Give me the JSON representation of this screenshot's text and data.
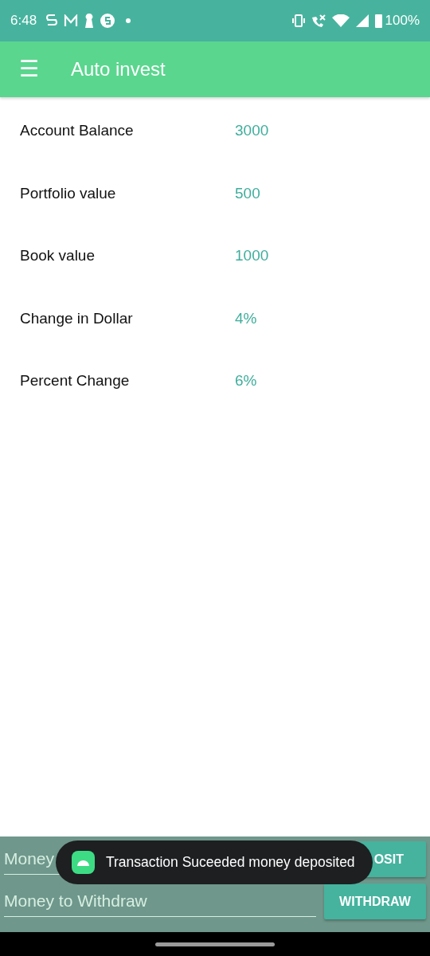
{
  "status_bar": {
    "time": "6:48",
    "battery": "100%"
  },
  "app_bar": {
    "menu_icon": "☰",
    "title": "Auto invest"
  },
  "rows": [
    {
      "label": "Account Balance",
      "value": "3000"
    },
    {
      "label": "Portfolio value",
      "value": "500"
    },
    {
      "label": "Book value",
      "value": "1000"
    },
    {
      "label": "Change in Dollar",
      "value": "4%"
    },
    {
      "label": "Percent Change",
      "value": "6%"
    }
  ],
  "deposit": {
    "placeholder": "Money",
    "button": "OSIT"
  },
  "withdraw": {
    "placeholder": "Money to Withdraw",
    "button": "WITHDRAW"
  },
  "toast": {
    "message": "Transaction Suceeded money deposited"
  }
}
